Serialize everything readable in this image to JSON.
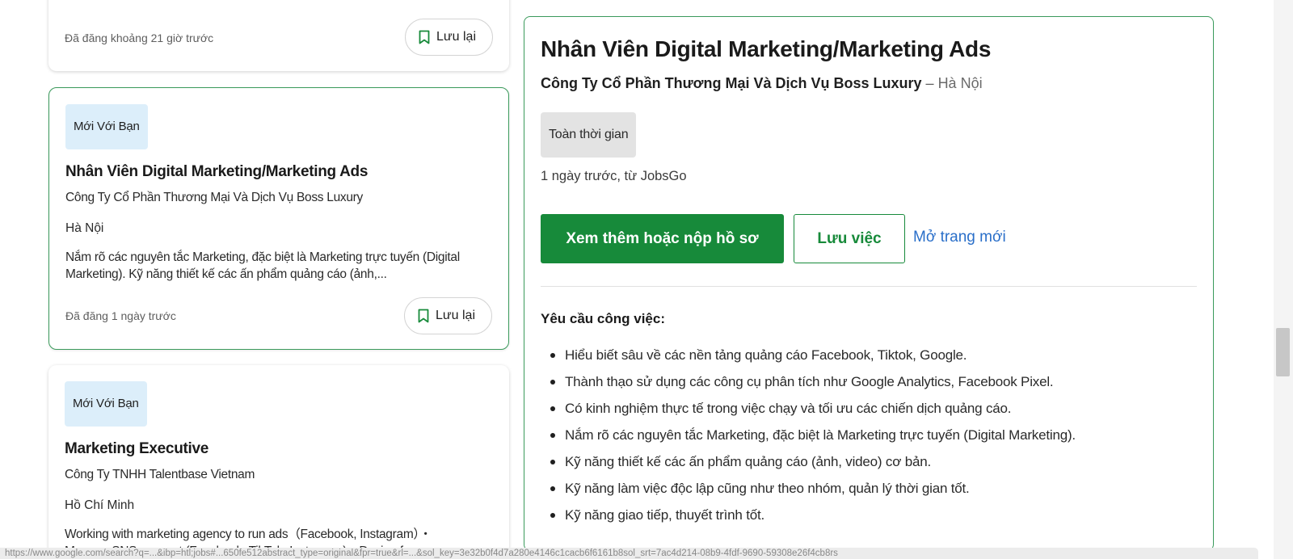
{
  "listing": {
    "save_label": "Lưu lại",
    "cards": [
      {
        "posted": "Đã đăng khoảng 21 giờ trước"
      },
      {
        "badge": "Mới Với Bạn",
        "title": "Nhân Viên Digital Marketing/Marketing Ads",
        "company": "Công Ty Cổ Phần Thương Mại Và Dịch Vụ Boss Luxury",
        "location": "Hà Nội",
        "snippet": "Nắm rõ các nguyên tắc Marketing, đặc biệt là Marketing trực tuyến (Digital Marketing). Kỹ năng thiết kế các ấn phẩm quảng cáo (ảnh,...",
        "posted": "Đã đăng 1 ngày trước"
      },
      {
        "badge": "Mới Với Bạn",
        "title": "Marketing Executive",
        "company": "Công Ty TNHH Talentbase Vietnam",
        "location": "Hồ Chí Minh",
        "snippet": "Working with marketing agency to run ads（Facebook, Instagram）・ Manage SNS account (Facebook, TikTok, Instagram)・Design for..."
      }
    ]
  },
  "detail": {
    "title": "Nhân Viên Digital Marketing/Marketing Ads",
    "company": "Công Ty Cổ Phần Thương Mại Và Dịch Vụ Boss Luxury",
    "separator": " – ",
    "location": "Hà Nội",
    "job_type": "Toàn thời gian",
    "meta": "1 ngày trước, từ JobsGo",
    "apply_label": "Xem thêm hoặc nộp hồ sơ",
    "save_label": "Lưu việc",
    "open_new_label": "Mở trang mới",
    "requirements_heading": "Yêu cầu công việc:",
    "requirements": [
      "Hiểu biết sâu về các nền tảng quảng cáo Facebook, Tiktok, Google.",
      "Thành thạo sử dụng các công cụ phân tích như Google Analytics, Facebook Pixel.",
      "Có kinh nghiệm thực tế trong việc chạy và tối ưu các chiến dịch quảng cáo.",
      "Nắm rõ các nguyên tắc Marketing, đặc biệt là Marketing trực tuyến (Digital Marketing).",
      "Kỹ năng thiết kế các ấn phẩm quảng cáo (ảnh, video) cơ bản.",
      "Kỹ năng làm việc độc lập cũng như theo nhóm, quản lý thời gian tốt.",
      "Kỹ năng giao tiếp, thuyết trình tốt."
    ]
  },
  "status_bar": {
    "url": "https://www.google.com/search?q=...&ibp=htl;jobs#...650fe512abstract_type=original&fpr=true&rl=...&sol_key=3e32b0f4d7a280e4146c1cacb6f6161b8sol_srt=7ac4d214-08b9-4fdf-9690-59308e26f4cb8rs"
  },
  "colors": {
    "accent_green": "#178a3a",
    "selected_border": "#3a9a5b",
    "badge_bg": "#dceefa",
    "link_blue": "#2a6fc9"
  },
  "icons": {
    "save": "bookmark-icon"
  }
}
